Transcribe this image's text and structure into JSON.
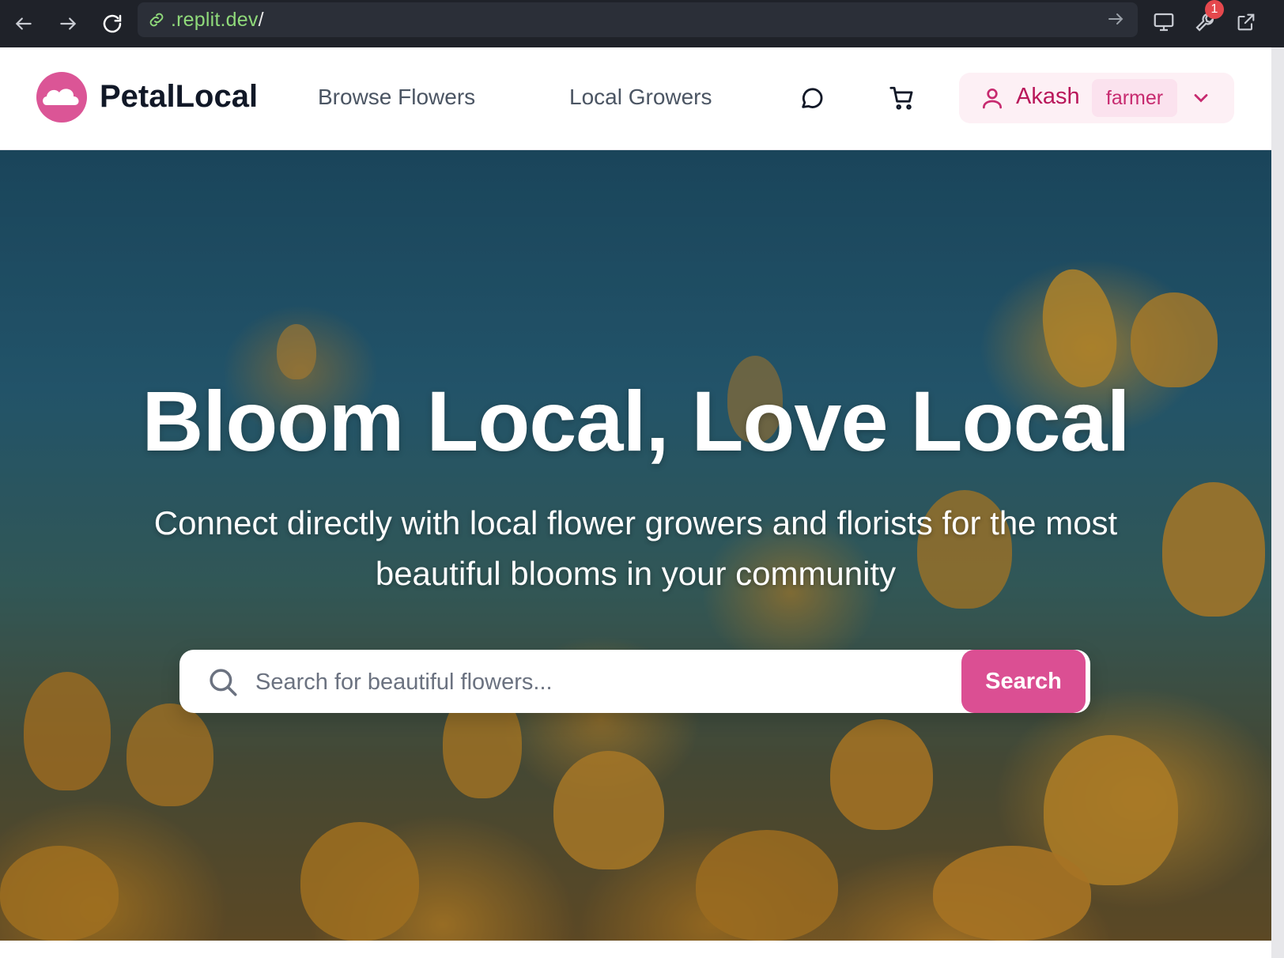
{
  "browser": {
    "url_domain": ".replit.dev",
    "url_path": "/",
    "notification_count": "1",
    "icons": [
      "back-arrow-icon",
      "forward-arrow-icon",
      "reload-icon",
      "link-icon",
      "go-arrow-icon",
      "monitor-icon",
      "wrench-icon",
      "external-link-icon"
    ]
  },
  "header": {
    "brand": "PetalLocal",
    "nav": [
      "Browse Flowers",
      "Local Growers"
    ],
    "icons": [
      "chat-bubble-icon",
      "cart-icon"
    ],
    "user": {
      "name": "Akash",
      "role": "farmer"
    }
  },
  "hero": {
    "title": "Bloom Local, Love Local",
    "subtitle": "Connect directly with local flower growers and florists for the most beautiful blooms in your community",
    "search": {
      "placeholder": "Search for beautiful flowers...",
      "value": "",
      "button_label": "Search"
    }
  },
  "colors": {
    "brand_pink": "#db4f93",
    "chrome_bg": "#1f2229",
    "url_green": "#8fd97a",
    "user_pill_bg": "#fdf0f5"
  }
}
